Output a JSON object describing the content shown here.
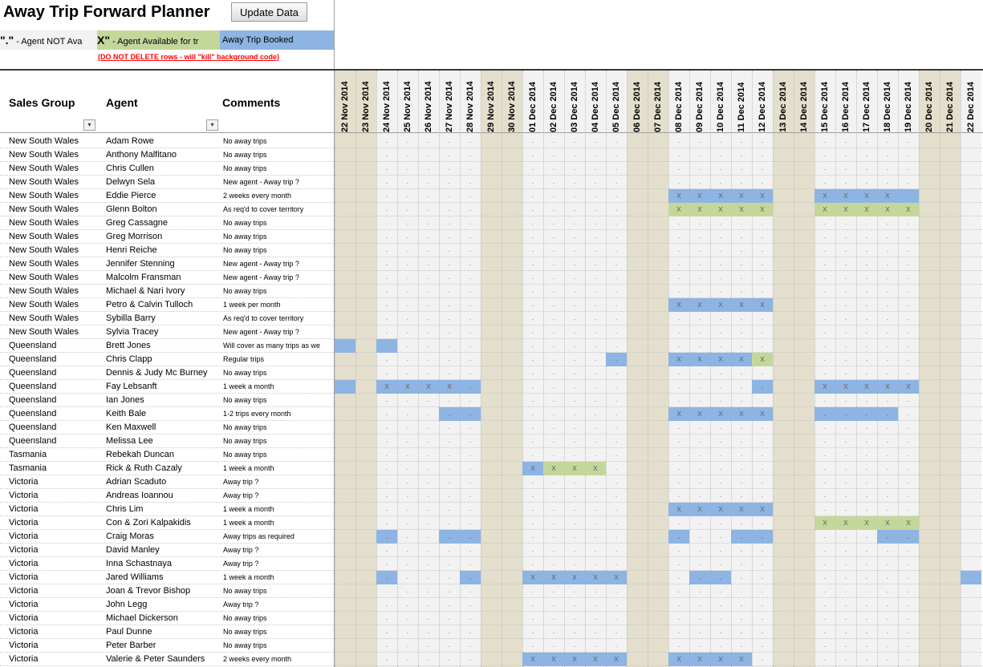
{
  "app": {
    "title": "Away Trip Forward Planner",
    "update_button": "Update Data",
    "legend": {
      "not_available_symbol": "\".\"",
      "not_available_text": "  -   Agent NOT Ava",
      "available_symbol": "X\"",
      "available_text": "  -   Agent Available for tr",
      "booked_text": "Away Trip Booked"
    },
    "warning": "(DO NOT DELETE rows - will \"kill\" background code)"
  },
  "colors": {
    "booked": "#8db4e2",
    "available": "#c4d79b",
    "weekend": "#e3dfcc",
    "weekday": "#f2f2f2"
  },
  "headers": {
    "sales_group": "Sales Group",
    "agent": "Agent",
    "comments": "Comments"
  },
  "dates": [
    {
      "label": "22 Nov 2014",
      "we": true
    },
    {
      "label": "23 Nov 2014",
      "we": true
    },
    {
      "label": "24 Nov 2014",
      "we": false
    },
    {
      "label": "25 Nov 2014",
      "we": false
    },
    {
      "label": "26 Nov 2014",
      "we": false
    },
    {
      "label": "27 Nov 2014",
      "we": false
    },
    {
      "label": "28 Nov 2014",
      "we": false
    },
    {
      "label": "29 Nov 2014",
      "we": true
    },
    {
      "label": "30 Nov 2014",
      "we": true
    },
    {
      "label": "01 Dec 2014",
      "we": false
    },
    {
      "label": "02 Dec 2014",
      "we": false
    },
    {
      "label": "03 Dec 2014",
      "we": false
    },
    {
      "label": "04 Dec 2014",
      "we": false
    },
    {
      "label": "05 Dec 2014",
      "we": false
    },
    {
      "label": "06 Dec 2014",
      "we": true
    },
    {
      "label": "07 Dec 2014",
      "we": true
    },
    {
      "label": "08 Dec 2014",
      "we": false
    },
    {
      "label": "09 Dec 2014",
      "we": false
    },
    {
      "label": "10 Dec 2014",
      "we": false
    },
    {
      "label": "11 Dec 2014",
      "we": false
    },
    {
      "label": "12 Dec 2014",
      "we": false
    },
    {
      "label": "13 Dec 2014",
      "we": true
    },
    {
      "label": "14 Dec 2014",
      "we": true
    },
    {
      "label": "15 Dec 2014",
      "we": false
    },
    {
      "label": "16 Dec 2014",
      "we": false
    },
    {
      "label": "17 Dec 2014",
      "we": false
    },
    {
      "label": "18 Dec 2014",
      "we": false
    },
    {
      "label": "19 Dec 2014",
      "we": false
    },
    {
      "label": "20 Dec 2014",
      "we": true
    },
    {
      "label": "21 Dec 2014",
      "we": true
    },
    {
      "label": "22 Dec 2014",
      "we": false
    }
  ],
  "rows": [
    {
      "sg": "New South Wales",
      "agent": "Adam Rowe",
      "comment": "No away trips",
      "cells": "  .....  .....  .....  ..... "
    },
    {
      "sg": "New South Wales",
      "agent": "Anthony Malfitano",
      "comment": "No away trips",
      "cells": "  .....  .....  .....  ..... "
    },
    {
      "sg": "New South Wales",
      "agent": "Chris Cullen",
      "comment": "No away trips",
      "cells": "  .....  .....  .....  ..... "
    },
    {
      "sg": "New South Wales",
      "agent": "Delwyn Sela",
      "comment": "New agent - Away trip ?",
      "cells": "  .....  .....  .....  ..... "
    },
    {
      "sg": "New South Wales",
      "agent": "Eddie Pierce",
      "comment": "2 weeks every month",
      "cells": "  .....  .....  XXXXX  XXXXB "
    },
    {
      "sg": "New South Wales",
      "agent": "Glenn Bolton",
      "comment": "As req'd to cover territory",
      "cells": "  .....  .....  xxxxx  xxxxx "
    },
    {
      "sg": "New South Wales",
      "agent": "Greg Cassagne",
      "comment": "No away trips",
      "cells": "  .....  .....  .....  ..... "
    },
    {
      "sg": "New South Wales",
      "agent": "Greg Morrison",
      "comment": "No away trips",
      "cells": "  .....  .....  .....  ..... "
    },
    {
      "sg": "New South Wales",
      "agent": "Henri Reiche",
      "comment": "No away trips",
      "cells": "  .....  .....  .....  ..... "
    },
    {
      "sg": "New South Wales",
      "agent": "Jennifer Stenning",
      "comment": "New agent - Away trip ?",
      "cells": "  .....  .....  .....  ..... "
    },
    {
      "sg": "New South Wales",
      "agent": "Malcolm Fransman",
      "comment": "New agent - Away trip ?",
      "cells": "  .....  .....  .....  ..... "
    },
    {
      "sg": "New South Wales",
      "agent": "Michael & Nari Ivory",
      "comment": "No away trips",
      "cells": "  .....  .....  .....  ..... "
    },
    {
      "sg": "New South Wales",
      "agent": "Petro & Calvin Tulloch",
      "comment": "1 week per month",
      "cells": "  .....  .....  XXXXX  ..... "
    },
    {
      "sg": "New South Wales",
      "agent": "Sybilla Barry",
      "comment": "As req'd to cover territory",
      "cells": "  .....  .....  .....  ..... "
    },
    {
      "sg": "New South Wales",
      "agent": "Sylvia Tracey",
      "comment": "New agent - Away trip ?",
      "cells": "  .....  .....  .....  ..... "
    },
    {
      "sg": "Queensland",
      "agent": "Brett Jones",
      "comment": "Will cover as many trips as we",
      "cells": "B B....  .....  .....  ..... "
    },
    {
      "sg": "Queensland",
      "agent": "Chris Clapp",
      "comment": "Regular trips",
      "cells": "  .....  ....D  XXXXx  ..... "
    },
    {
      "sg": "Queensland",
      "agent": "Dennis & Judy Mc Burney",
      "comment": "No away trips",
      "cells": "  .....  .....  .....  ..... "
    },
    {
      "sg": "Queensland",
      "agent": "Fay Lebsanft",
      "comment": "1 week a month",
      "cells": "B XXXXD  .....  ....D  XXXXX "
    },
    {
      "sg": "Queensland",
      "agent": "Ian Jones",
      "comment": "No away trips",
      "cells": "  .....  .....  .....  ..... "
    },
    {
      "sg": "Queensland",
      "agent": "Keith Bale",
      "comment": "1-2 trips every month",
      "cells": "  ...DD  .....  XXXXX  DDDD. "
    },
    {
      "sg": "Queensland",
      "agent": "Ken Maxwell",
      "comment": "No away trips",
      "cells": "  .....  .....  .....  ..... "
    },
    {
      "sg": "Queensland",
      "agent": "Melissa Lee",
      "comment": "No away trips",
      "cells": "  .....  .....  .....  ..... "
    },
    {
      "sg": "Tasmania",
      "agent": "Rebekah Duncan",
      "comment": "No away trips",
      "cells": "  .....  .....  .....  ..... "
    },
    {
      "sg": "Tasmania",
      "agent": "Rick & Ruth Cazaly",
      "comment": "1 week a month",
      "cells": "  .....  Xxxx.  .....  ..... "
    },
    {
      "sg": "Victoria",
      "agent": "Adrian Scaduto",
      "comment": "Away trip ?",
      "cells": "  .....  .....  .....  ..... "
    },
    {
      "sg": "Victoria",
      "agent": "Andreas Ioannou",
      "comment": "Away trip ?",
      "cells": "  .....  .....  .....  ..... "
    },
    {
      "sg": "Victoria",
      "agent": "Chris Lim",
      "comment": "1 week a month",
      "cells": "  .....  .....  XXXXX  ..... "
    },
    {
      "sg": "Victoria",
      "agent": "Con & Zori Kalpakidis",
      "comment": "1 week a month",
      "cells": "  .....  .....  .....  xxxxx "
    },
    {
      "sg": "Victoria",
      "agent": "Craig Moras",
      "comment": "Away trips as required",
      "cells": "  D..DD  .....  D..DD  ...DD "
    },
    {
      "sg": "Victoria",
      "agent": "David Manley",
      "comment": "Away trip ?",
      "cells": "  .....  .....  .....  ..... "
    },
    {
      "sg": "Victoria",
      "agent": "Inna Schastnaya",
      "comment": "Away trip ?",
      "cells": "  .....  .....  .....  ..... "
    },
    {
      "sg": "Victoria",
      "agent": "Jared Williams",
      "comment": "1 week a month",
      "cells": "  D...D  XXXXX  .DD..  .....  B"
    },
    {
      "sg": "Victoria",
      "agent": "Joan & Trevor Bishop",
      "comment": "No away trips",
      "cells": "  .....  .....  .....  ..... "
    },
    {
      "sg": "Victoria",
      "agent": "John Legg",
      "comment": "Away trip ?",
      "cells": "  .....  .....  .....  ..... "
    },
    {
      "sg": "Victoria",
      "agent": "Michael Dickerson",
      "comment": "No away trips",
      "cells": "  .....  .....  .....  ..... "
    },
    {
      "sg": "Victoria",
      "agent": "Paul Dunne",
      "comment": "No away trips",
      "cells": "  .....  .....  .....  ..... "
    },
    {
      "sg": "Victoria",
      "agent": "Peter Barber",
      "comment": "No away trips",
      "cells": "  .....  .....  .....  ..... "
    },
    {
      "sg": "Victoria",
      "agent": "Valerie & Peter Saunders",
      "comment": "2 weeks every month",
      "cells": "  .....  XXXXX  XXXX.  ..... "
    }
  ]
}
